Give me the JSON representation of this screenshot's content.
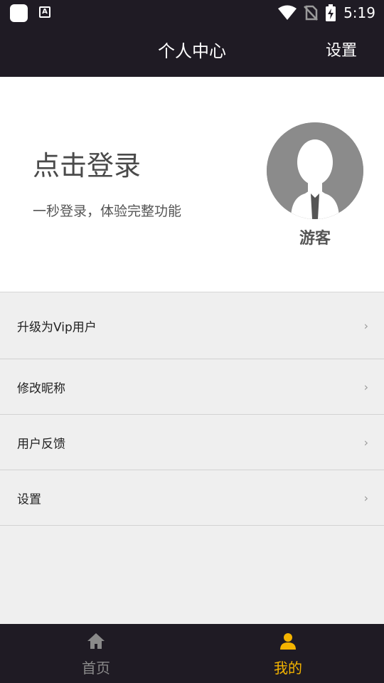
{
  "status_bar": {
    "time": "5:19",
    "icons": [
      "app-icon",
      "font-a-icon",
      "wifi-icon",
      "no-sim-icon",
      "battery-charging-icon"
    ]
  },
  "header": {
    "title": "个人中心",
    "settings_label": "设置"
  },
  "profile": {
    "login_title": "点击登录",
    "login_subtitle": "一秒登录，体验完整功能",
    "avatar_icon": "default-avatar-icon",
    "guest_name": "游客"
  },
  "menu": {
    "items": [
      {
        "label": "升级为Vip用户",
        "icon": "chevron-right-icon"
      },
      {
        "label": "修改昵称",
        "icon": "chevron-right-icon"
      },
      {
        "label": "用户反馈",
        "icon": "chevron-right-icon"
      },
      {
        "label": "设置",
        "icon": "chevron-right-icon"
      }
    ],
    "chevron": "›"
  },
  "tabbar": {
    "tabs": [
      {
        "label": "首页",
        "icon": "home-icon",
        "active": false
      },
      {
        "label": "我的",
        "icon": "user-icon",
        "active": true
      }
    ],
    "active_color": "#f4b400",
    "inactive_color": "#8a8a8a"
  },
  "colors": {
    "header_bg": "#1f1b24",
    "page_bg": "#efefef"
  }
}
